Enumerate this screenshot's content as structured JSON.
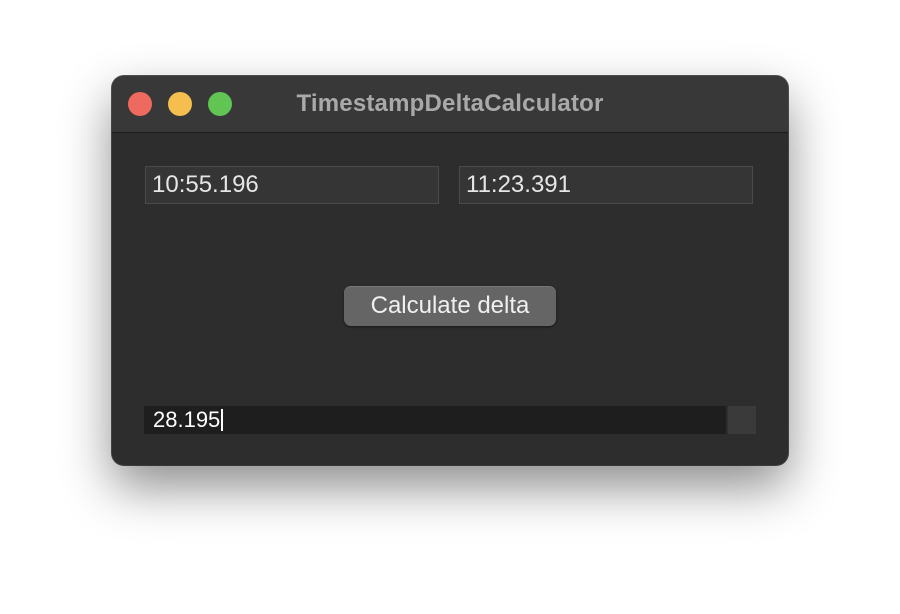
{
  "window": {
    "title": "TimestampDeltaCalculator"
  },
  "inputs": {
    "start_time": "10:55.196",
    "end_time": "11:23.391"
  },
  "actions": {
    "calculate_label": "Calculate delta"
  },
  "output": {
    "delta": "28.195"
  },
  "colors": {
    "close": "#ee6a5e",
    "minimize": "#f5bf4f",
    "zoom": "#61c554",
    "window_bg": "#2d2d2d"
  }
}
